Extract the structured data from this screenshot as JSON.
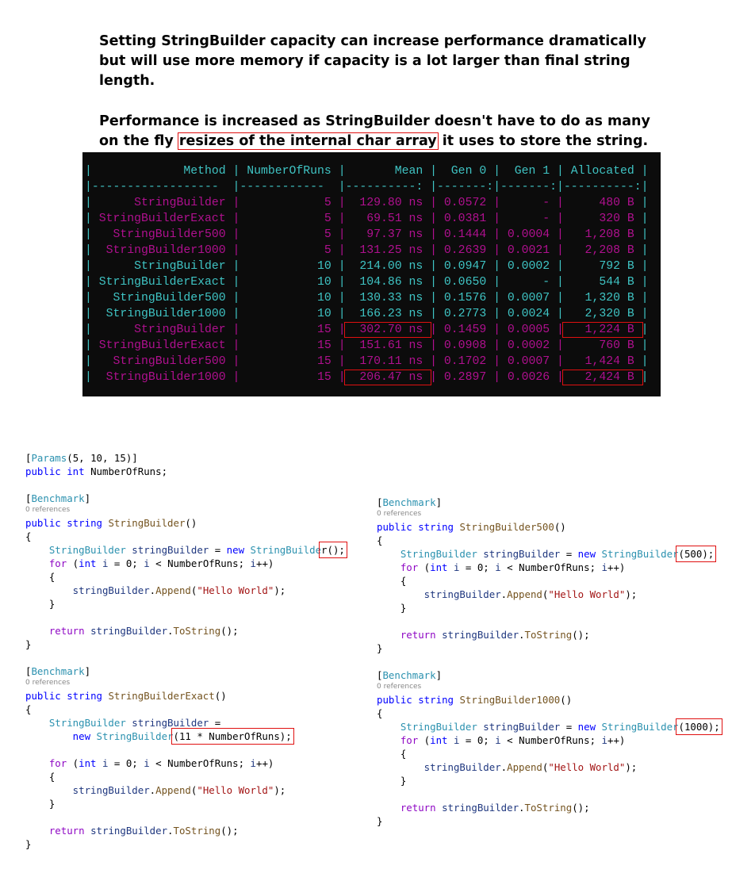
{
  "intro": {
    "para1": "Setting StringBuilder capacity can increase performance dramatically but will use more memory if capacity is a lot larger than final string length.",
    "para2_before": "Performance is increased as StringBuilder doesn't have to do as many on the fly ",
    "para2_highlight": "resizes of the internal char array",
    "para2_after": " it uses to store the string."
  },
  "colors": {
    "magenta_rows": "#b0108f",
    "cyan_rows": "#3fc4c4",
    "highlight_box": "#e01010",
    "terminal_bg": "#0c0c0c"
  },
  "table": {
    "headers": [
      "Method",
      "NumberOfRuns",
      "Mean",
      "Gen 0",
      "Gen 1",
      "Allocated"
    ],
    "separator": [
      "------------------ ",
      "------------ ",
      "----------:",
      "-------:",
      "-------:",
      "----------:"
    ],
    "rows": [
      {
        "color": "magenta",
        "cells": [
          "StringBuilder",
          "5",
          "129.80 ns",
          "0.0572",
          "-",
          "480 B"
        ]
      },
      {
        "color": "magenta",
        "cells": [
          "StringBuilderExact",
          "5",
          "69.51 ns",
          "0.0381",
          "-",
          "320 B"
        ]
      },
      {
        "color": "magenta",
        "cells": [
          "StringBuilder500",
          "5",
          "97.37 ns",
          "0.1444",
          "0.0004",
          "1,208 B"
        ]
      },
      {
        "color": "magenta",
        "cells": [
          "StringBuilder1000",
          "5",
          "131.25 ns",
          "0.2639",
          "0.0021",
          "2,208 B"
        ]
      },
      {
        "color": "cyan",
        "cells": [
          "StringBuilder",
          "10",
          "214.00 ns",
          "0.0947",
          "0.0002",
          "792 B"
        ]
      },
      {
        "color": "cyan",
        "cells": [
          "StringBuilderExact",
          "10",
          "104.86 ns",
          "0.0650",
          "-",
          "544 B"
        ]
      },
      {
        "color": "cyan",
        "cells": [
          "StringBuilder500",
          "10",
          "130.33 ns",
          "0.1576",
          "0.0007",
          "1,320 B"
        ]
      },
      {
        "color": "cyan",
        "cells": [
          "StringBuilder1000",
          "10",
          "166.23 ns",
          "0.2773",
          "0.0024",
          "2,320 B"
        ]
      },
      {
        "color": "magenta",
        "cells": [
          "StringBuilder",
          "15",
          "302.70 ns",
          "0.1459",
          "0.0005",
          "1,224 B"
        ],
        "highlighted": [
          2,
          5
        ]
      },
      {
        "color": "magenta",
        "cells": [
          "StringBuilderExact",
          "15",
          "151.61 ns",
          "0.0908",
          "0.0002",
          "760 B"
        ]
      },
      {
        "color": "magenta",
        "cells": [
          "StringBuilder500",
          "15",
          "170.11 ns",
          "0.1702",
          "0.0007",
          "1,424 B"
        ]
      },
      {
        "color": "magenta",
        "cells": [
          "StringBuilder1000",
          "15",
          "206.47 ns",
          "0.2897",
          "0.0026",
          "2,424 B"
        ],
        "highlighted": [
          2,
          5
        ]
      }
    ]
  },
  "code_left": [
    [
      [
        "[",
        "p"
      ],
      [
        "Params",
        "t"
      ],
      [
        "(5, 10, 15)]",
        "p"
      ]
    ],
    [
      [
        "public",
        "k"
      ],
      [
        " int",
        "k"
      ],
      [
        " NumberOfRuns;",
        "p"
      ]
    ],
    [],
    [
      [
        "[",
        "p"
      ],
      [
        "Benchmark",
        "t"
      ],
      [
        "]",
        "p"
      ]
    ],
    "0 references",
    [
      [
        "public",
        "k"
      ],
      [
        " string",
        "k"
      ],
      [
        " StringBuilder",
        "m"
      ],
      [
        "()",
        "p"
      ]
    ],
    [
      [
        "{",
        "p"
      ]
    ],
    [
      [
        "    StringBuilder",
        "t"
      ],
      [
        " stringBuilder",
        "v"
      ],
      [
        " = ",
        "p"
      ],
      [
        "new",
        "k"
      ],
      [
        " StringBuilde",
        "t"
      ],
      [
        "r();",
        "hl"
      ]
    ],
    [
      [
        "    for",
        "c"
      ],
      [
        " (",
        "p"
      ],
      [
        "int",
        "k"
      ],
      [
        " i",
        "v"
      ],
      [
        " = 0; ",
        "p"
      ],
      [
        "i",
        "v"
      ],
      [
        " < NumberOfRuns; ",
        "p"
      ],
      [
        "i",
        "v"
      ],
      [
        "++)",
        "p"
      ]
    ],
    [
      [
        "    {",
        "p"
      ]
    ],
    [
      [
        "        stringBuilder",
        "v"
      ],
      [
        ".",
        "p"
      ],
      [
        "Append",
        "m"
      ],
      [
        "(",
        "p"
      ],
      [
        "\"Hello World\"",
        "s"
      ],
      [
        ");",
        "p"
      ]
    ],
    [
      [
        "    }",
        "p"
      ]
    ],
    [],
    [
      [
        "    return",
        "c"
      ],
      [
        " stringBuilder",
        "v"
      ],
      [
        ".",
        "p"
      ],
      [
        "ToString",
        "m"
      ],
      [
        "();",
        "p"
      ]
    ],
    [
      [
        "}",
        "p"
      ]
    ],
    [],
    [
      [
        "[",
        "p"
      ],
      [
        "Benchmark",
        "t"
      ],
      [
        "]",
        "p"
      ]
    ],
    "0 references",
    [
      [
        "public",
        "k"
      ],
      [
        " string",
        "k"
      ],
      [
        " StringBuilderExact",
        "m"
      ],
      [
        "()",
        "p"
      ]
    ],
    [
      [
        "{",
        "p"
      ]
    ],
    [
      [
        "    StringBuilder",
        "t"
      ],
      [
        " stringBuilder",
        "v"
      ],
      [
        " =",
        "p"
      ]
    ],
    [
      [
        "        new",
        "k"
      ],
      [
        " StringBuilder",
        "t"
      ],
      [
        "(11 * NumberOfRuns);",
        "hl"
      ]
    ],
    [],
    [
      [
        "    for",
        "c"
      ],
      [
        " (",
        "p"
      ],
      [
        "int",
        "k"
      ],
      [
        " i",
        "v"
      ],
      [
        " = 0; ",
        "p"
      ],
      [
        "i",
        "v"
      ],
      [
        " < NumberOfRuns; ",
        "p"
      ],
      [
        "i",
        "v"
      ],
      [
        "++)",
        "p"
      ]
    ],
    [
      [
        "    {",
        "p"
      ]
    ],
    [
      [
        "        stringBuilder",
        "v"
      ],
      [
        ".",
        "p"
      ],
      [
        "Append",
        "m"
      ],
      [
        "(",
        "p"
      ],
      [
        "\"Hello World\"",
        "s"
      ],
      [
        ");",
        "p"
      ]
    ],
    [
      [
        "    }",
        "p"
      ]
    ],
    [],
    [
      [
        "    return",
        "c"
      ],
      [
        " stringBuilder",
        "v"
      ],
      [
        ".",
        "p"
      ],
      [
        "ToString",
        "m"
      ],
      [
        "();",
        "p"
      ]
    ],
    [
      [
        "}",
        "p"
      ]
    ]
  ],
  "code_right": [
    [
      [
        "[",
        "p"
      ],
      [
        "Benchmark",
        "t"
      ],
      [
        "]",
        "p"
      ]
    ],
    "0 references",
    [
      [
        "public",
        "k"
      ],
      [
        " string",
        "k"
      ],
      [
        " StringBuilder500",
        "m"
      ],
      [
        "()",
        "p"
      ]
    ],
    [
      [
        "{",
        "p"
      ]
    ],
    [
      [
        "    StringBuilder",
        "t"
      ],
      [
        " stringBuilder",
        "v"
      ],
      [
        " = ",
        "p"
      ],
      [
        "new",
        "k"
      ],
      [
        " StringBuilder",
        "t"
      ],
      [
        "(500);",
        "hl"
      ]
    ],
    [
      [
        "    for",
        "c"
      ],
      [
        " (",
        "p"
      ],
      [
        "int",
        "k"
      ],
      [
        " i",
        "v"
      ],
      [
        " = 0; ",
        "p"
      ],
      [
        "i",
        "v"
      ],
      [
        " < NumberOfRuns; ",
        "p"
      ],
      [
        "i",
        "v"
      ],
      [
        "++)",
        "p"
      ]
    ],
    [
      [
        "    {",
        "p"
      ]
    ],
    [
      [
        "        stringBuilder",
        "v"
      ],
      [
        ".",
        "p"
      ],
      [
        "Append",
        "m"
      ],
      [
        "(",
        "p"
      ],
      [
        "\"Hello World\"",
        "s"
      ],
      [
        ");",
        "p"
      ]
    ],
    [
      [
        "    }",
        "p"
      ]
    ],
    [],
    [
      [
        "    return",
        "c"
      ],
      [
        " stringBuilder",
        "v"
      ],
      [
        ".",
        "p"
      ],
      [
        "ToString",
        "m"
      ],
      [
        "();",
        "p"
      ]
    ],
    [
      [
        "}",
        "p"
      ]
    ],
    [],
    [
      [
        "[",
        "p"
      ],
      [
        "Benchmark",
        "t"
      ],
      [
        "]",
        "p"
      ]
    ],
    "0 references",
    [
      [
        "public",
        "k"
      ],
      [
        " string",
        "k"
      ],
      [
        " StringBuilder1000",
        "m"
      ],
      [
        "()",
        "p"
      ]
    ],
    [
      [
        "{",
        "p"
      ]
    ],
    [
      [
        "    StringBuilder",
        "t"
      ],
      [
        " stringBuilder",
        "v"
      ],
      [
        " = ",
        "p"
      ],
      [
        "new",
        "k"
      ],
      [
        " StringBuilder",
        "t"
      ],
      [
        "(1000);",
        "hl"
      ]
    ],
    [
      [
        "    for",
        "c"
      ],
      [
        " (",
        "p"
      ],
      [
        "int",
        "k"
      ],
      [
        " i",
        "v"
      ],
      [
        " = 0; ",
        "p"
      ],
      [
        "i",
        "v"
      ],
      [
        " < NumberOfRuns; ",
        "p"
      ],
      [
        "i",
        "v"
      ],
      [
        "++)",
        "p"
      ]
    ],
    [
      [
        "    {",
        "p"
      ]
    ],
    [
      [
        "        stringBuilder",
        "v"
      ],
      [
        ".",
        "p"
      ],
      [
        "Append",
        "m"
      ],
      [
        "(",
        "p"
      ],
      [
        "\"Hello World\"",
        "s"
      ],
      [
        ");",
        "p"
      ]
    ],
    [
      [
        "    }",
        "p"
      ]
    ],
    [],
    [
      [
        "    return",
        "c"
      ],
      [
        " stringBuilder",
        "v"
      ],
      [
        ".",
        "p"
      ],
      [
        "ToString",
        "m"
      ],
      [
        "();",
        "p"
      ]
    ],
    [
      [
        "}",
        "p"
      ]
    ]
  ]
}
